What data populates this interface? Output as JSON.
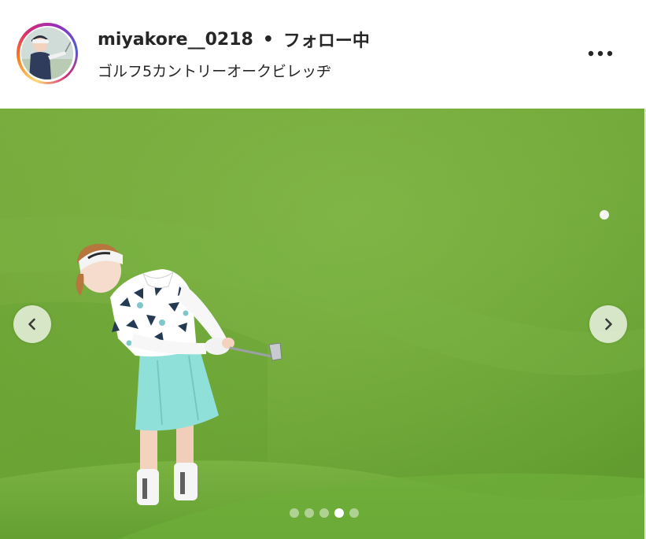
{
  "post": {
    "author": {
      "username": "miyakore__0218",
      "separator": "•",
      "follow_status": "フォロー中",
      "location": "ゴルフ5カントリーオークビレッヂ"
    },
    "more_icon": "more-horizontal-icon",
    "carousel": {
      "prev_icon": "chevron-left-icon",
      "next_icon": "chevron-right-icon",
      "slide_count": 5,
      "active_slide": 4
    },
    "colors": {
      "avatar_ring": [
        "#feda75",
        "#fa7e1e",
        "#d62976",
        "#962fbf",
        "#4f5bd5"
      ],
      "text": "#262626",
      "fairway": "#6fa634"
    }
  }
}
